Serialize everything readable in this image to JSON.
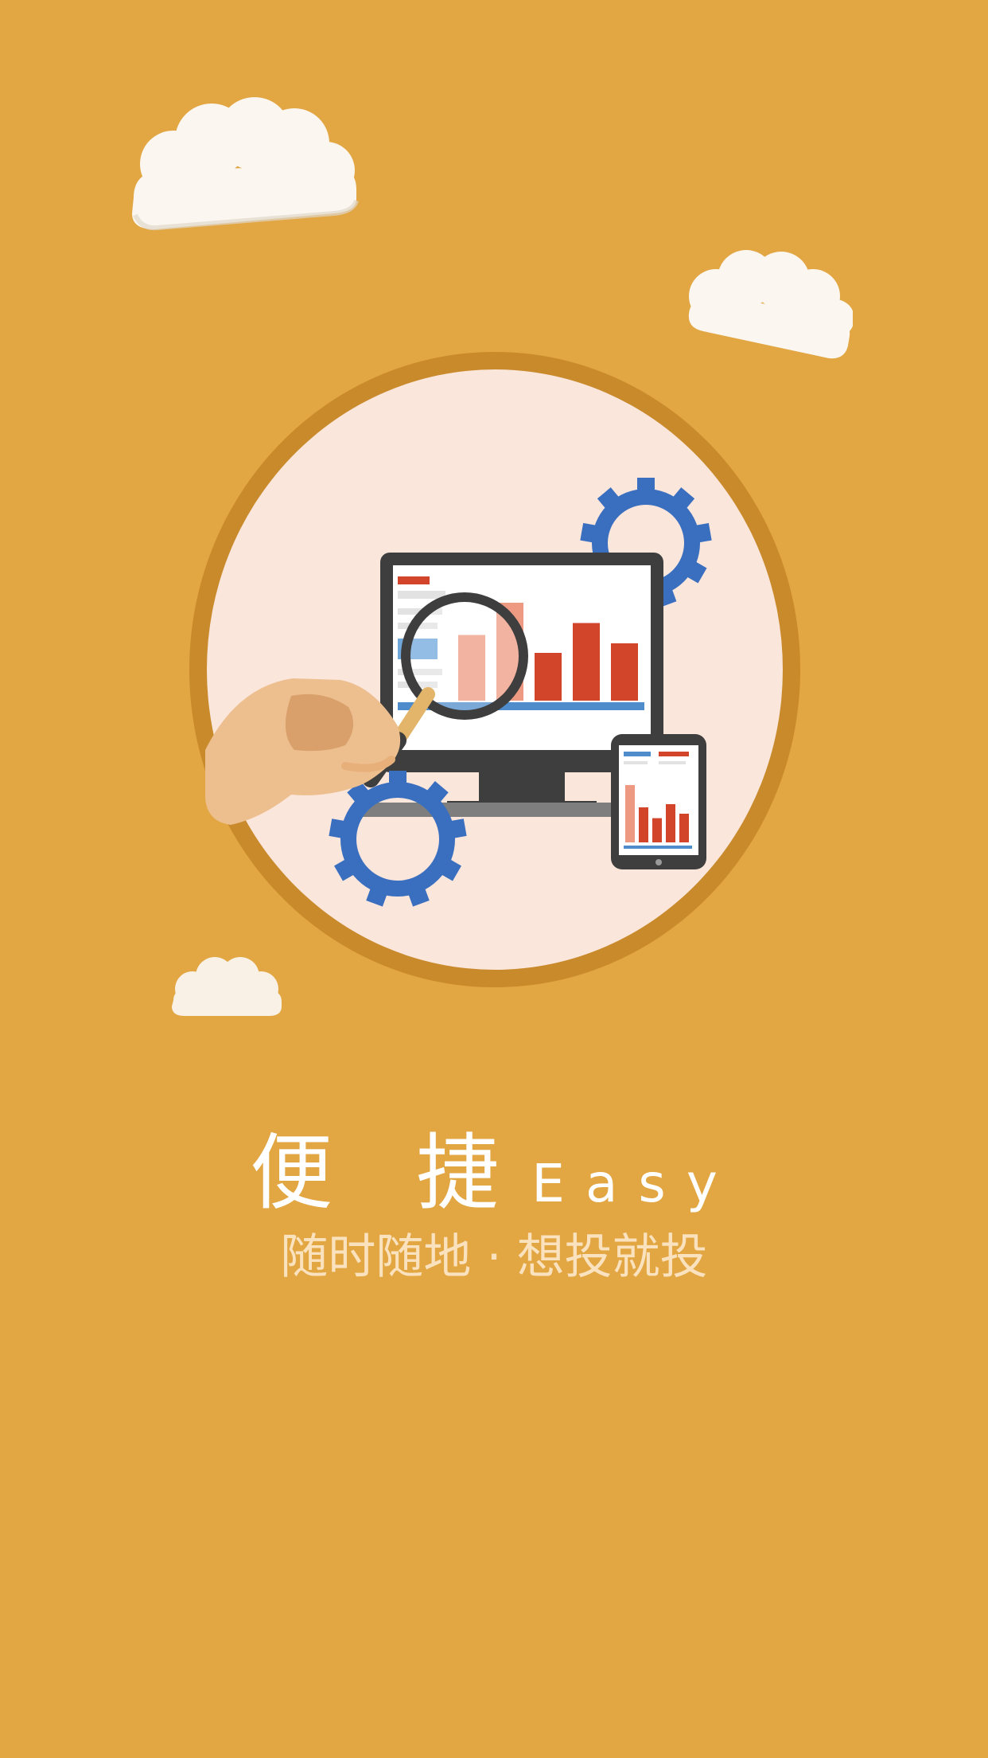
{
  "colors": {
    "background": "#E2A642",
    "circle_ring": "#C98A2C",
    "circle_fill": "#FBE6DC",
    "gear_blue": "#3A6FBF",
    "bar_red": "#D2452A",
    "bar_salmon": "#EE9A82",
    "skin": "#EDBE8E",
    "skin_shadow": "#D9A06B",
    "monitor_dark": "#3E3E3E",
    "title_text": "#FFFFFF",
    "subtitle_text": "#FAE2BE",
    "cloud": "#FBF6EF"
  },
  "illustration": {
    "icons": [
      "cloud-icon",
      "gear-icon",
      "monitor-icon",
      "magnifier-icon",
      "hand-icon",
      "tablet-icon",
      "bar-chart-icon"
    ],
    "monitor_bars": [
      0.55,
      0.82,
      0.4,
      0.65,
      0.48
    ],
    "tablet_bars": [
      0.9,
      0.55,
      0.38,
      0.6,
      0.45
    ]
  },
  "title": {
    "cn": "便 捷",
    "en": "Easy"
  },
  "subtitle": "随时随地 · 想投就投"
}
